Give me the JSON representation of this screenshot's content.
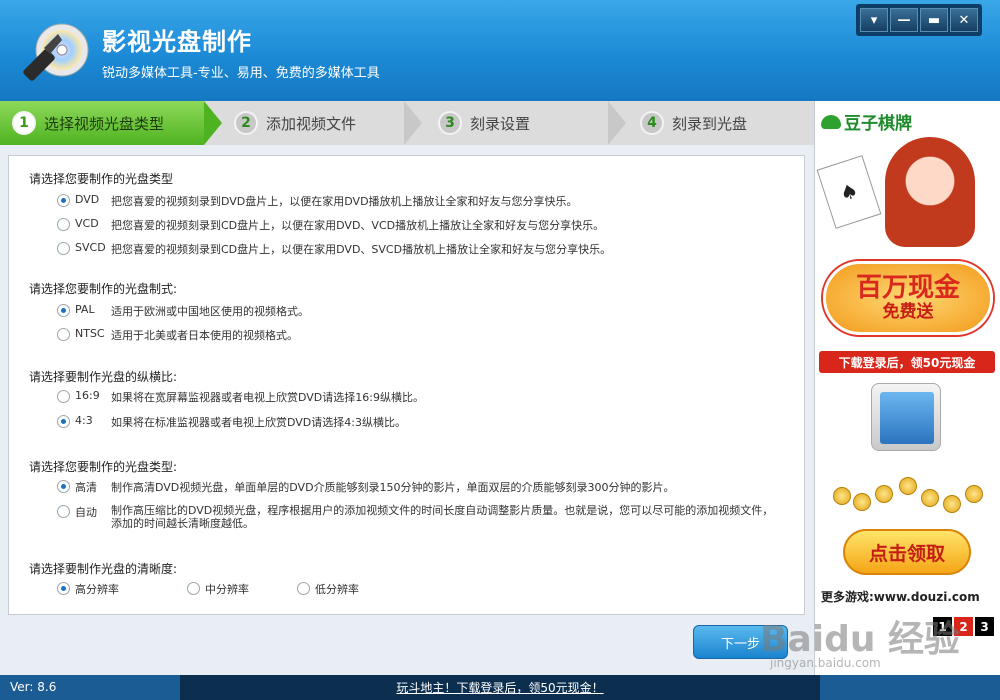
{
  "app": {
    "title": "影视光盘制作",
    "subtitle": "锐动多媒体工具-专业、易用、免费的多媒体工具"
  },
  "window_controls": [
    "▾",
    "—",
    "▬",
    "✕"
  ],
  "steps": [
    {
      "num": "1",
      "label": "选择视频光盘类型",
      "active": true
    },
    {
      "num": "2",
      "label": "添加视频文件",
      "active": false
    },
    {
      "num": "3",
      "label": "刻录设置",
      "active": false
    },
    {
      "num": "4",
      "label": "刻录到光盘",
      "active": false
    }
  ],
  "sections": {
    "disc_type": {
      "title": "请选择您要制作的光盘类型",
      "options": [
        {
          "label": "DVD",
          "desc": "把您喜爱的视频刻录到DVD盘片上，以便在家用DVD播放机上播放让全家和好友与您分享快乐。",
          "checked": true
        },
        {
          "label": "VCD",
          "desc": "把您喜爱的视频刻录到CD盘片上，以便在家用DVD、VCD播放机上播放让全家和好友与您分享快乐。",
          "checked": false
        },
        {
          "label": "SVCD",
          "desc": "把您喜爱的视频刻录到CD盘片上，以便在家用DVD、SVCD播放机上播放让全家和好友与您分享快乐。",
          "checked": false
        }
      ]
    },
    "tv_format": {
      "title": "请选择您要制作的光盘制式:",
      "options": [
        {
          "label": "PAL",
          "desc": "适用于欧洲或中国地区使用的视频格式。",
          "checked": true
        },
        {
          "label": "NTSC",
          "desc": "适用于北美或者日本使用的视频格式。",
          "checked": false
        }
      ]
    },
    "aspect": {
      "title": "请选择要制作光盘的纵横比:",
      "options": [
        {
          "label": "16:9",
          "desc": "如果将在宽屏幕监视器或者电视上欣赏DVD请选择16:9纵横比。",
          "checked": false
        },
        {
          "label": "4:3",
          "desc": "如果将在标准监视器或者电视上欣赏DVD请选择4:3纵横比。",
          "checked": true
        }
      ]
    },
    "quality_type": {
      "title": "请选择您要制作的光盘类型:",
      "options": [
        {
          "label": "高清",
          "desc": "制作高清DVD视频光盘，单面单层的DVD介质能够刻录150分钟的影片，单面双层的介质能够刻录300分钟的影片。",
          "checked": true
        },
        {
          "label": "自动",
          "desc": "制作高压缩比的DVD视频光盘，程序根据用户的添加视频文件的时间长度自动调整影片质量。也就是说，您可以尽可能的添加视频文件，添加的时间越长清晰度越低。",
          "checked": false
        }
      ]
    },
    "resolution": {
      "title": "请选择要制作光盘的清晰度:",
      "options": [
        {
          "label": "高分辨率",
          "checked": true
        },
        {
          "label": "中分辨率",
          "checked": false
        },
        {
          "label": "低分辨率",
          "checked": false
        }
      ]
    }
  },
  "next_button": "下一步",
  "ad": {
    "brand": "豆子棋牌",
    "big_text": "百万现金",
    "big_sub": "免费送",
    "red_banner": "下载登录后，领50元现金",
    "claim_button": "点击领取",
    "more_link": "更多游戏:www.douzi.com",
    "pages": [
      "1",
      "2",
      "3"
    ],
    "active_page": "2"
  },
  "status": {
    "version": "Ver: 8.6",
    "ticker": "玩斗地主！下载登录后，领50元现金！"
  },
  "watermark": {
    "main": "Baidu 经验",
    "sub": "jingyan.baidu.com"
  }
}
